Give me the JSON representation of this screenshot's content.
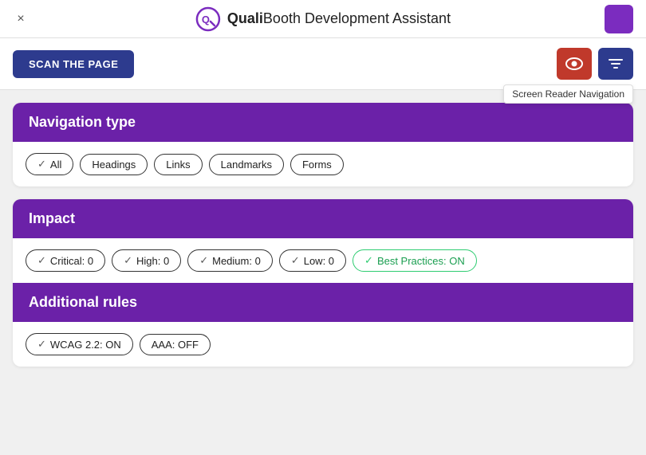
{
  "titleBar": {
    "closeLabel": "×",
    "brandBold": "Quali",
    "brandLight": "Booth",
    "appName": " Development Assistant"
  },
  "toolbar": {
    "scanLabel": "SCAN THE PAGE",
    "tooltip": "Screen Reader Navigation"
  },
  "navigationTypeCard": {
    "title": "Navigation type",
    "filters": [
      {
        "id": "all",
        "label": "All",
        "checked": true
      },
      {
        "id": "headings",
        "label": "Headings",
        "checked": false
      },
      {
        "id": "links",
        "label": "Links",
        "checked": false
      },
      {
        "id": "landmarks",
        "label": "Landmarks",
        "checked": false
      },
      {
        "id": "forms",
        "label": "Forms",
        "checked": false
      }
    ]
  },
  "impactCard": {
    "title": "Impact",
    "filters": [
      {
        "id": "critical",
        "label": "Critical: 0",
        "checked": true,
        "green": false
      },
      {
        "id": "high",
        "label": "High: 0",
        "checked": true,
        "green": false
      },
      {
        "id": "medium",
        "label": "Medium: 0",
        "checked": true,
        "green": false
      },
      {
        "id": "low",
        "label": "Low: 0",
        "checked": true,
        "green": false
      },
      {
        "id": "bestpractices",
        "label": "Best Practices: ON",
        "checked": true,
        "green": true
      }
    ]
  },
  "additionalRulesCard": {
    "title": "Additional rules",
    "filters": [
      {
        "id": "wcag",
        "label": "WCAG 2.2: ON",
        "checked": true,
        "green": false
      },
      {
        "id": "aaa",
        "label": "AAA: OFF",
        "checked": false,
        "green": false
      }
    ]
  }
}
